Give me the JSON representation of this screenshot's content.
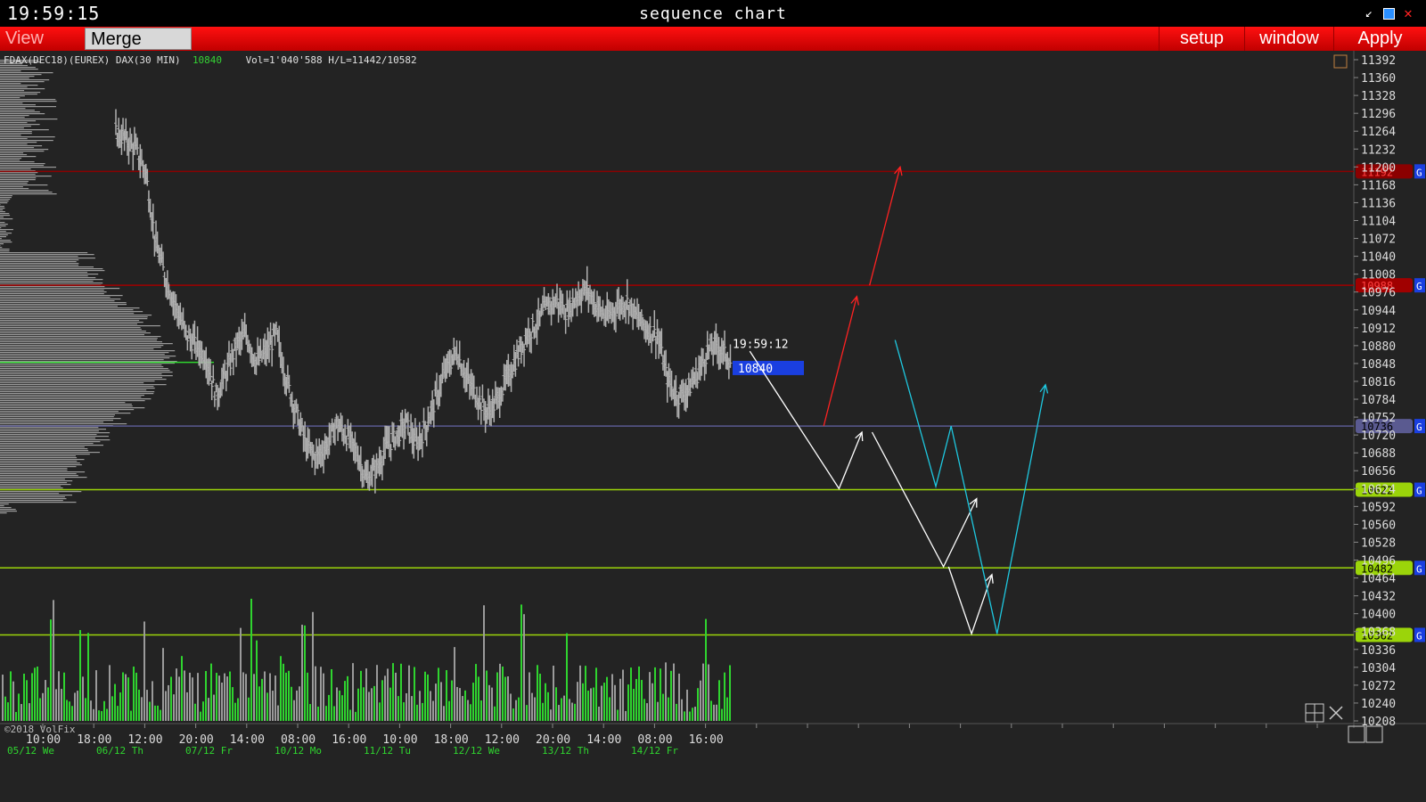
{
  "window": {
    "clock": "19:59:15",
    "title": "sequence chart"
  },
  "toolbar": {
    "view_dom": "View DOM",
    "merge": "Merge Contr",
    "setup": "setup",
    "window": "window",
    "apply": "Apply"
  },
  "info": {
    "instrument": "FDAX(DEC18)(EUREX) DAX(30 MIN)",
    "last": "10840",
    "stats": "Vol=1'040'588 H/L=11442/10582"
  },
  "copyright": "©2018 VolFix",
  "colors": {
    "background": "#232323",
    "red": "#ff1a1a",
    "green": "#2fd42f",
    "blue": "#1a3fe0",
    "cyan": "#00d8f0",
    "lime": "#9bd40a"
  },
  "chart_data": {
    "type": "candlestick",
    "y_ticks": [
      "11392",
      "11360",
      "11328",
      "11296",
      "11264",
      "11232",
      "11200",
      "11168",
      "11136",
      "11104",
      "11072",
      "11040",
      "11008",
      "10976",
      "10944",
      "10912",
      "10880",
      "10848",
      "10816",
      "10784",
      "10752",
      "10720",
      "10688",
      "10656",
      "10624",
      "10592",
      "10560",
      "10528",
      "10496",
      "10464",
      "10432",
      "10400",
      "10368",
      "10336",
      "10304",
      "10272",
      "10240",
      "10208"
    ],
    "ylim": [
      10208,
      11392
    ],
    "x_time_labels": [
      "10:00",
      "18:00",
      "12:00",
      "20:00",
      "14:00",
      "08:00",
      "16:00",
      "10:00",
      "18:00",
      "12:00",
      "20:00",
      "14:00",
      "08:00",
      "16:00"
    ],
    "x_date_labels": [
      "05/12 We",
      "06/12 Th",
      "07/12 Fr",
      "10/12 Mo",
      "11/12 Tu",
      "12/12 We",
      "13/12 Th",
      "14/12 Fr"
    ],
    "current_price": {
      "time": "19:59:12",
      "price": "10840"
    },
    "levels": [
      {
        "price": 11192,
        "label": "11192",
        "color": "#8b0000"
      },
      {
        "price": 10988,
        "label": "10988",
        "color": "#a00000"
      },
      {
        "price": 10736,
        "label": "10736",
        "color": "#5a5a90"
      },
      {
        "price": 10622,
        "label": "10622",
        "color": "#9bd40a"
      },
      {
        "price": 10482,
        "label": "10482",
        "color": "#9bd40a"
      },
      {
        "price": 10362,
        "label": "10362",
        "color": "#9bd40a"
      }
    ],
    "level_tag": "G",
    "price_path": [
      [
        0.0,
        11262
      ],
      [
        0.5,
        11250
      ],
      [
        1.0,
        11230
      ],
      [
        1.5,
        11190
      ],
      [
        2.0,
        11060
      ],
      [
        2.5,
        11000
      ],
      [
        3.0,
        10950
      ],
      [
        3.5,
        10900
      ],
      [
        4.0,
        10880
      ],
      [
        4.5,
        10860
      ],
      [
        5.0,
        10790
      ],
      [
        5.5,
        10830
      ],
      [
        6.0,
        10880
      ],
      [
        6.5,
        10900
      ],
      [
        7.0,
        10850
      ],
      [
        7.5,
        10870
      ],
      [
        8.0,
        10900
      ],
      [
        8.5,
        10820
      ],
      [
        9.0,
        10760
      ],
      [
        9.5,
        10700
      ],
      [
        10.0,
        10680
      ],
      [
        10.5,
        10700
      ],
      [
        11.0,
        10740
      ],
      [
        11.5,
        10720
      ],
      [
        12.0,
        10690
      ],
      [
        12.5,
        10640
      ],
      [
        13.0,
        10660
      ],
      [
        13.5,
        10700
      ],
      [
        14.0,
        10720
      ],
      [
        14.5,
        10740
      ],
      [
        15.0,
        10700
      ],
      [
        15.5,
        10740
      ],
      [
        16.0,
        10790
      ],
      [
        16.5,
        10840
      ],
      [
        17.0,
        10870
      ],
      [
        17.5,
        10820
      ],
      [
        18.0,
        10790
      ],
      [
        18.5,
        10760
      ],
      [
        19.0,
        10780
      ],
      [
        19.5,
        10820
      ],
      [
        20.0,
        10860
      ],
      [
        20.5,
        10900
      ],
      [
        21.0,
        10920
      ],
      [
        21.5,
        10950
      ],
      [
        22.0,
        10960
      ],
      [
        22.5,
        10940
      ],
      [
        23.0,
        10970
      ],
      [
        23.5,
        10980
      ],
      [
        24.0,
        10950
      ],
      [
        24.5,
        10930
      ],
      [
        25.0,
        10950
      ],
      [
        25.5,
        10960
      ],
      [
        26.0,
        10930
      ],
      [
        26.5,
        10910
      ],
      [
        27.0,
        10900
      ],
      [
        27.5,
        10820
      ],
      [
        28.0,
        10790
      ],
      [
        28.5,
        10800
      ],
      [
        29.0,
        10830
      ],
      [
        29.5,
        10870
      ],
      [
        30.0,
        10880
      ],
      [
        30.5,
        10860
      ],
      [
        31.0,
        10840
      ]
    ],
    "projections": [
      {
        "color": "#ffffff",
        "points": [
          [
            14.1,
            10870
          ],
          [
            17.6,
            10624
          ],
          [
            18.5,
            10725
          ]
        ]
      },
      {
        "color": "#ffffff",
        "points": [
          [
            18.9,
            10725
          ],
          [
            21.7,
            10484
          ],
          [
            23.0,
            10606
          ]
        ]
      },
      {
        "color": "#ffffff",
        "points": [
          [
            21.9,
            10484
          ],
          [
            22.8,
            10364
          ],
          [
            23.6,
            10470
          ]
        ]
      },
      {
        "color": "#ff2222",
        "points": [
          [
            17.0,
            10736
          ],
          [
            18.3,
            10968
          ]
        ]
      },
      {
        "color": "#ff2222",
        "points": [
          [
            18.8,
            10988
          ],
          [
            20.0,
            11200
          ]
        ]
      },
      {
        "color": "#1ec8e0",
        "points": [
          [
            19.8,
            10890
          ],
          [
            21.4,
            10628
          ],
          [
            22.0,
            10736
          ],
          [
            23.8,
            10364
          ],
          [
            25.7,
            10810
          ]
        ]
      }
    ]
  }
}
